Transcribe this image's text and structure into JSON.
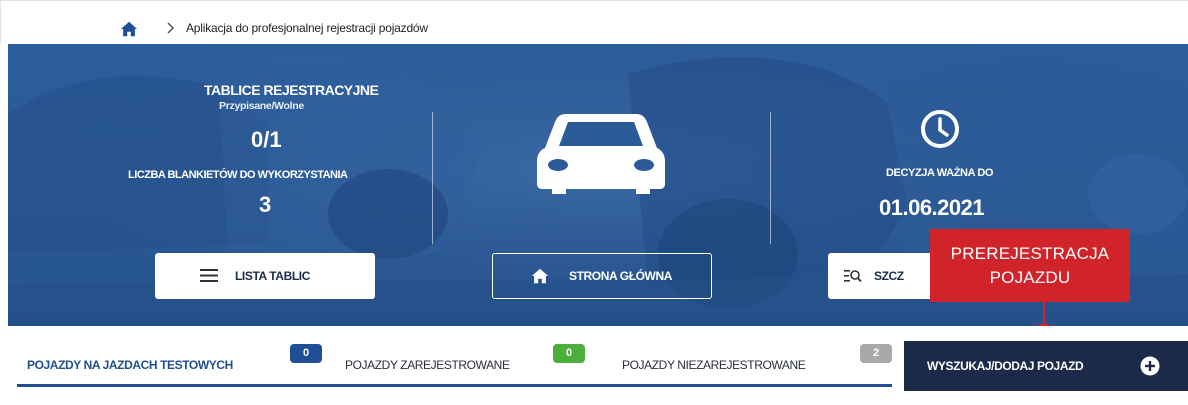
{
  "breadcrumb": {
    "home_icon": "home-icon",
    "separator_icon": "chevron-right-icon",
    "current": "Aplikacja do profesjonalnej rejestracji pojazdów"
  },
  "summary": {
    "plates_title": "TABLICE REJESTRACYJNE",
    "plates_subtitle": "Przypisane/Wolne",
    "plates_value": "0/1",
    "blanks_label": "LICZBA BLANKIETÓW DO WYKORZYSTANIA",
    "blanks_value": "3",
    "center_icon": "car-icon",
    "decision_icon": "clock-icon",
    "decision_label": "DECYZJA WAŻNA DO",
    "decision_value": "01.06.2021"
  },
  "actions": {
    "list_plates": {
      "label": "LISTA TABLIC",
      "icon": "menu-icon"
    },
    "home": {
      "label": "STRONA GŁÓWNA",
      "icon": "home-icon"
    },
    "details": {
      "label": "SZCZ",
      "icon": "search-list-icon"
    }
  },
  "callout": {
    "line1": "PREREJESTRACJA",
    "line2": "POJAZDU",
    "color": "#d1232a"
  },
  "tabs": [
    {
      "label": "POJAZDY NA JAZDACH TESTOWYCH",
      "count": "0",
      "badge_color": "#1f4f95",
      "active": true
    },
    {
      "label": "POJAZDY ZAREJESTROWANE",
      "count": "0",
      "badge_color": "#4caf3b",
      "active": false
    },
    {
      "label": "POJAZDY NIEZAREJESTROWANE",
      "count": "2",
      "badge_color": "#a9a9a9",
      "active": false
    }
  ],
  "search_add": {
    "label": "WYSZUKAJ/DODAJ POJAZD",
    "icon": "plus-circle-icon"
  },
  "colors": {
    "hero_blue": "#2a5996",
    "primary": "#1f4f95",
    "dark_navy": "#1b2a49"
  }
}
